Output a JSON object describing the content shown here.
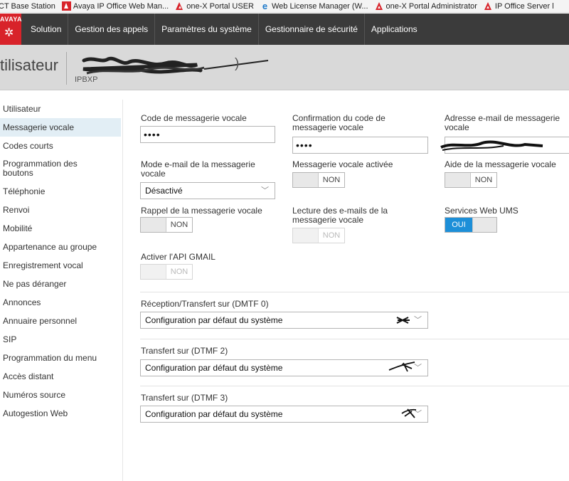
{
  "bookmarks": [
    {
      "icon": "none",
      "label": "CT Base Station"
    },
    {
      "icon": "avaya-box",
      "label": "Avaya IP Office Web Man..."
    },
    {
      "icon": "avaya-tri",
      "label": "one-X Portal USER"
    },
    {
      "icon": "ie",
      "label": "Web License Manager (W..."
    },
    {
      "icon": "avaya-tri",
      "label": "one-X Portal Administrator"
    },
    {
      "icon": "avaya-tri",
      "label": "IP Office Server l"
    }
  ],
  "logo": {
    "word": "AVAYA",
    "brand_color": "#d8232a"
  },
  "topnav": [
    {
      "label": "Solution"
    },
    {
      "label": "Gestion des appels"
    },
    {
      "label": "Paramètres du système"
    },
    {
      "label": "Gestionnaire de sécurité"
    },
    {
      "label": "Applications"
    }
  ],
  "header": {
    "title": "tilisateur",
    "name_suffix": ")",
    "subtitle": "IPBXP"
  },
  "sidebar": [
    {
      "label": "Utilisateur",
      "active": false
    },
    {
      "label": "Messagerie vocale",
      "active": true
    },
    {
      "label": "Codes courts",
      "active": false
    },
    {
      "label": "Programmation des boutons",
      "active": false
    },
    {
      "label": "Téléphonie",
      "active": false
    },
    {
      "label": "Renvoi",
      "active": false
    },
    {
      "label": "Mobilité",
      "active": false
    },
    {
      "label": "Appartenance au groupe",
      "active": false
    },
    {
      "label": "Enregistrement vocal",
      "active": false
    },
    {
      "label": "Ne pas déranger",
      "active": false
    },
    {
      "label": "Annonces",
      "active": false
    },
    {
      "label": "Annuaire personnel",
      "active": false
    },
    {
      "label": "SIP",
      "active": false
    },
    {
      "label": "Programmation du menu",
      "active": false
    },
    {
      "label": "Accès distant",
      "active": false
    },
    {
      "label": "Numéros source",
      "active": false
    },
    {
      "label": "Autogestion Web",
      "active": false
    }
  ],
  "form": {
    "vm_code": {
      "label": "Code de messagerie vocale",
      "value": "••••"
    },
    "vm_code_confirm": {
      "label": "Confirmation du code de messagerie vocale",
      "value": "••••"
    },
    "vm_email": {
      "label": "Adresse e-mail de messagerie vocale"
    },
    "vm_email_mode": {
      "label": "Mode e-mail de la messagerie vocale",
      "value": "Désactivé"
    },
    "vm_enabled": {
      "label": "Messagerie vocale activée",
      "state": "NON"
    },
    "vm_help": {
      "label": "Aide de la messagerie vocale",
      "state": "NON"
    },
    "vm_callback": {
      "label": "Rappel de la messagerie vocale",
      "state": "NON"
    },
    "vm_email_read": {
      "label": "Lecture des e-mails de la messagerie vocale",
      "state": "NON"
    },
    "ums_web": {
      "label": "Services Web UMS",
      "state": "OUI",
      "accent": "#1d8fd8"
    },
    "gmail_api": {
      "label": "Activer l'API GMAIL",
      "state": "NON"
    },
    "dtmf0": {
      "label": "Réception/Transfert sur (DMTF 0)",
      "value": "Configuration par défaut du système"
    },
    "dtmf2": {
      "label": "Transfert sur (DTMF 2)",
      "value": "Configuration par défaut du système"
    },
    "dtmf3": {
      "label": "Transfert sur (DTMF 3)",
      "value": "Configuration par défaut du système"
    }
  }
}
